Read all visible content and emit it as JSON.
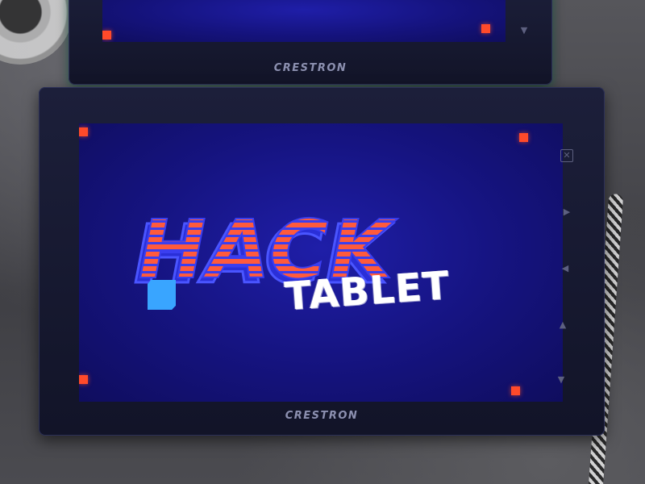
{
  "back_tablet": {
    "brand": "CRESTRON"
  },
  "front_tablet": {
    "brand": "CRESTRON",
    "screen": {
      "title_main": "HACK",
      "title_sub": "TABLET"
    },
    "side_buttons": [
      "close-icon",
      "play-icon",
      "back-icon",
      "up-icon",
      "down-icon"
    ]
  },
  "colors": {
    "screen_blue": "#15137e",
    "logo_orange": "#ff5a3c",
    "logo_blue": "#3a3ef0",
    "marker_red": "#ff4a2a",
    "cursor_cyan": "#39a5ff"
  }
}
